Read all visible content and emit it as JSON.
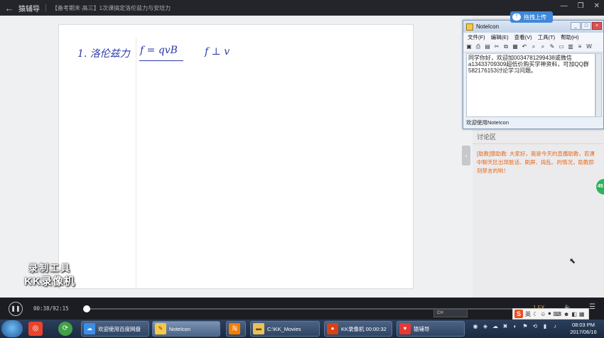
{
  "app": {
    "name": "猿辅导",
    "course_title": "【备考期末·高三】1次课搞定洛伦兹力与安培力"
  },
  "board": {
    "line1_label": "1. 洛伦兹力",
    "line1_formula": "f = qvB",
    "line1_note": "f ⊥ v"
  },
  "watermark": {
    "line1": "录制工具",
    "line2": "KK录像机"
  },
  "noteicon": {
    "title": "NoteIcon",
    "menu": [
      "文件(F)",
      "编辑(E)",
      "查看(V)",
      "工具(T)",
      "帮助(H)"
    ],
    "body": "同学你好，欢迎加0034781299438或微信a13433709309超低价购买学神资料，可加QQ群582176153讨论学习问题。",
    "status": "欢迎使用NoteIcon"
  },
  "upload_button": {
    "label": "拖拽上传"
  },
  "discussion": {
    "header": "讨论区",
    "message": "[助教]猿助教: 大家好，我是今天的直播助教，若课中聊天区出现脏话、刷屏、捣乱、的情况，助教即刻禁言的哟！"
  },
  "side_badge": "45",
  "player": {
    "time": "00:38/92:15",
    "progress": 0.007,
    "speed": "1.5X",
    "lang": "CH"
  },
  "taskbar": {
    "tasks": [
      {
        "label": "欢迎使用百度网盘",
        "icon": "baidu-netdisk-icon"
      },
      {
        "label": "NoteIcon",
        "icon": "noteicon-icon"
      },
      {
        "label": "",
        "icon": "taobao-icon"
      },
      {
        "label": "C:\\KK_Movies",
        "icon": "folder-icon"
      },
      {
        "label": "KK录像机 00:00:32",
        "icon": "kk-recorder-icon"
      },
      {
        "label": "猿辅导",
        "icon": "yuanfudao-icon"
      }
    ],
    "ime_label": "英",
    "clock_time": "08:03 PM",
    "clock_date": "2017/06/16"
  },
  "colors": {
    "accent": "#3f87d9",
    "ink": "#2b3aa8",
    "assistant_message": "#e56a1c",
    "progress_thumb": "#ffffff"
  }
}
